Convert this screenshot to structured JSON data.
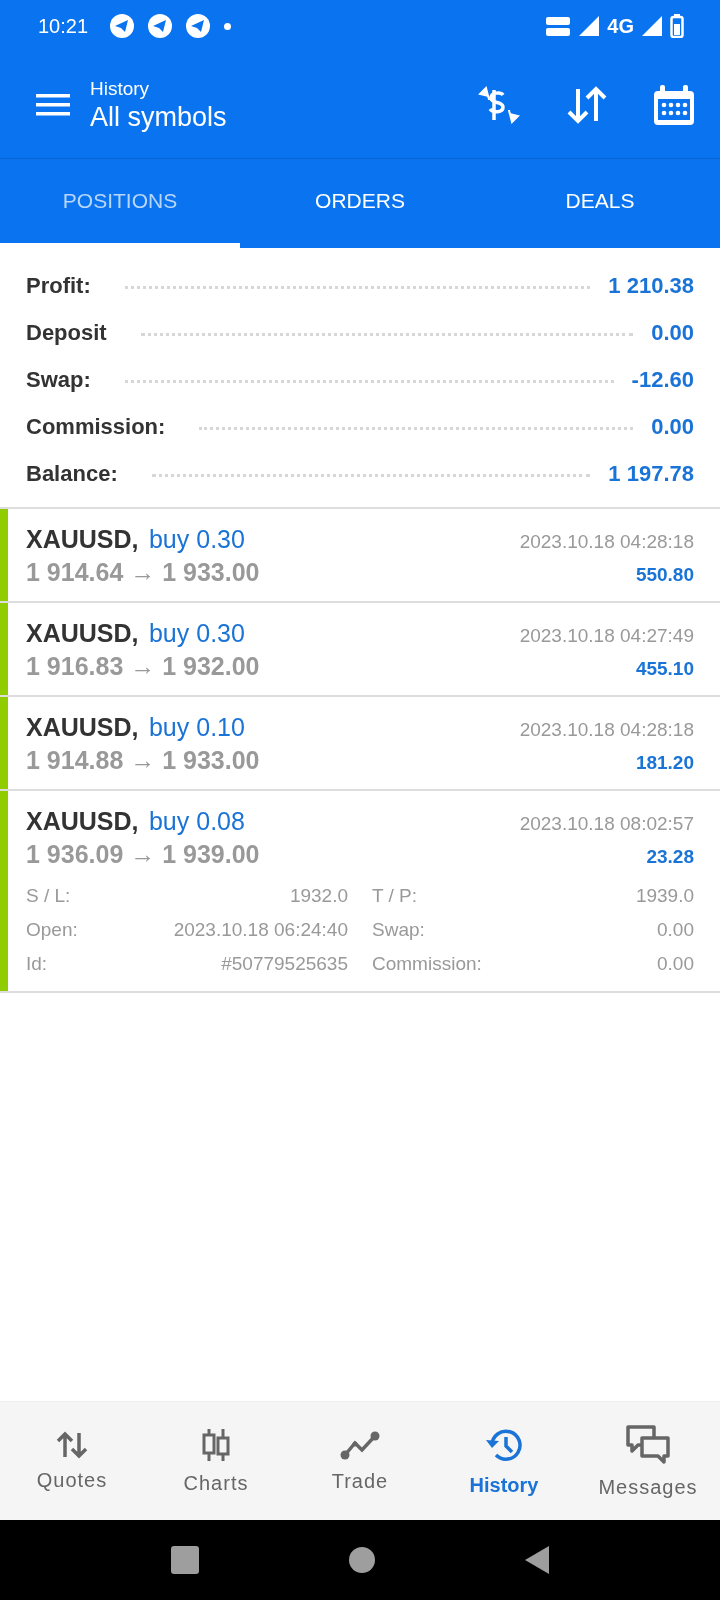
{
  "status_bar": {
    "time": "10:21",
    "network": "4G"
  },
  "header": {
    "subtitle": "History",
    "title": "All symbols"
  },
  "tabs": [
    {
      "label": "POSITIONS",
      "selected": true
    },
    {
      "label": "ORDERS",
      "selected": false
    },
    {
      "label": "DEALS",
      "selected": false
    }
  ],
  "summary": [
    {
      "label": "Profit:",
      "value": "1 210.38"
    },
    {
      "label": "Deposit",
      "value": "0.00"
    },
    {
      "label": "Swap:",
      "value": "-12.60"
    },
    {
      "label": "Commission:",
      "value": "0.00"
    },
    {
      "label": "Balance:",
      "value": "1 197.78"
    }
  ],
  "positions": [
    {
      "symbol": "XAUUSD,",
      "side": "buy 0.30",
      "prices": "1 914.64 → 1 933.00",
      "time": "2023.10.18 04:28:18",
      "profit": "550.80",
      "color": "#8fcc00"
    },
    {
      "symbol": "XAUUSD,",
      "side": "buy 0.30",
      "prices": "1 916.83 → 1 932.00",
      "time": "2023.10.18 04:27:49",
      "profit": "455.10",
      "color": "#8fcc00"
    },
    {
      "symbol": "XAUUSD,",
      "side": "buy 0.10",
      "prices": "1 914.88 → 1 933.00",
      "time": "2023.10.18 04:28:18",
      "profit": "181.20",
      "color": "#8fcc00"
    },
    {
      "symbol": "XAUUSD,",
      "side": "buy 0.08",
      "prices": "1 936.09 → 1 939.00",
      "time": "2023.10.18 08:02:57",
      "profit": "23.28",
      "color": "#8fcc00",
      "details": [
        {
          "label": "S / L:",
          "value": "1932.0"
        },
        {
          "label": "T / P:",
          "value": "1939.0"
        },
        {
          "label": "Open:",
          "value": "2023.10.18 06:24:40"
        },
        {
          "label": "Swap:",
          "value": "0.00"
        },
        {
          "label": "Id:",
          "value": "#50779525635"
        },
        {
          "label": "Commission:",
          "value": "0.00"
        }
      ]
    }
  ],
  "bottom_nav": [
    {
      "label": "Quotes",
      "kind": "quotes",
      "selected": false
    },
    {
      "label": "Charts",
      "kind": "charts",
      "selected": false
    },
    {
      "label": "Trade",
      "kind": "trade",
      "selected": false
    },
    {
      "label": "History",
      "kind": "history",
      "selected": true
    },
    {
      "label": "Messages",
      "kind": "messages",
      "selected": false
    }
  ]
}
